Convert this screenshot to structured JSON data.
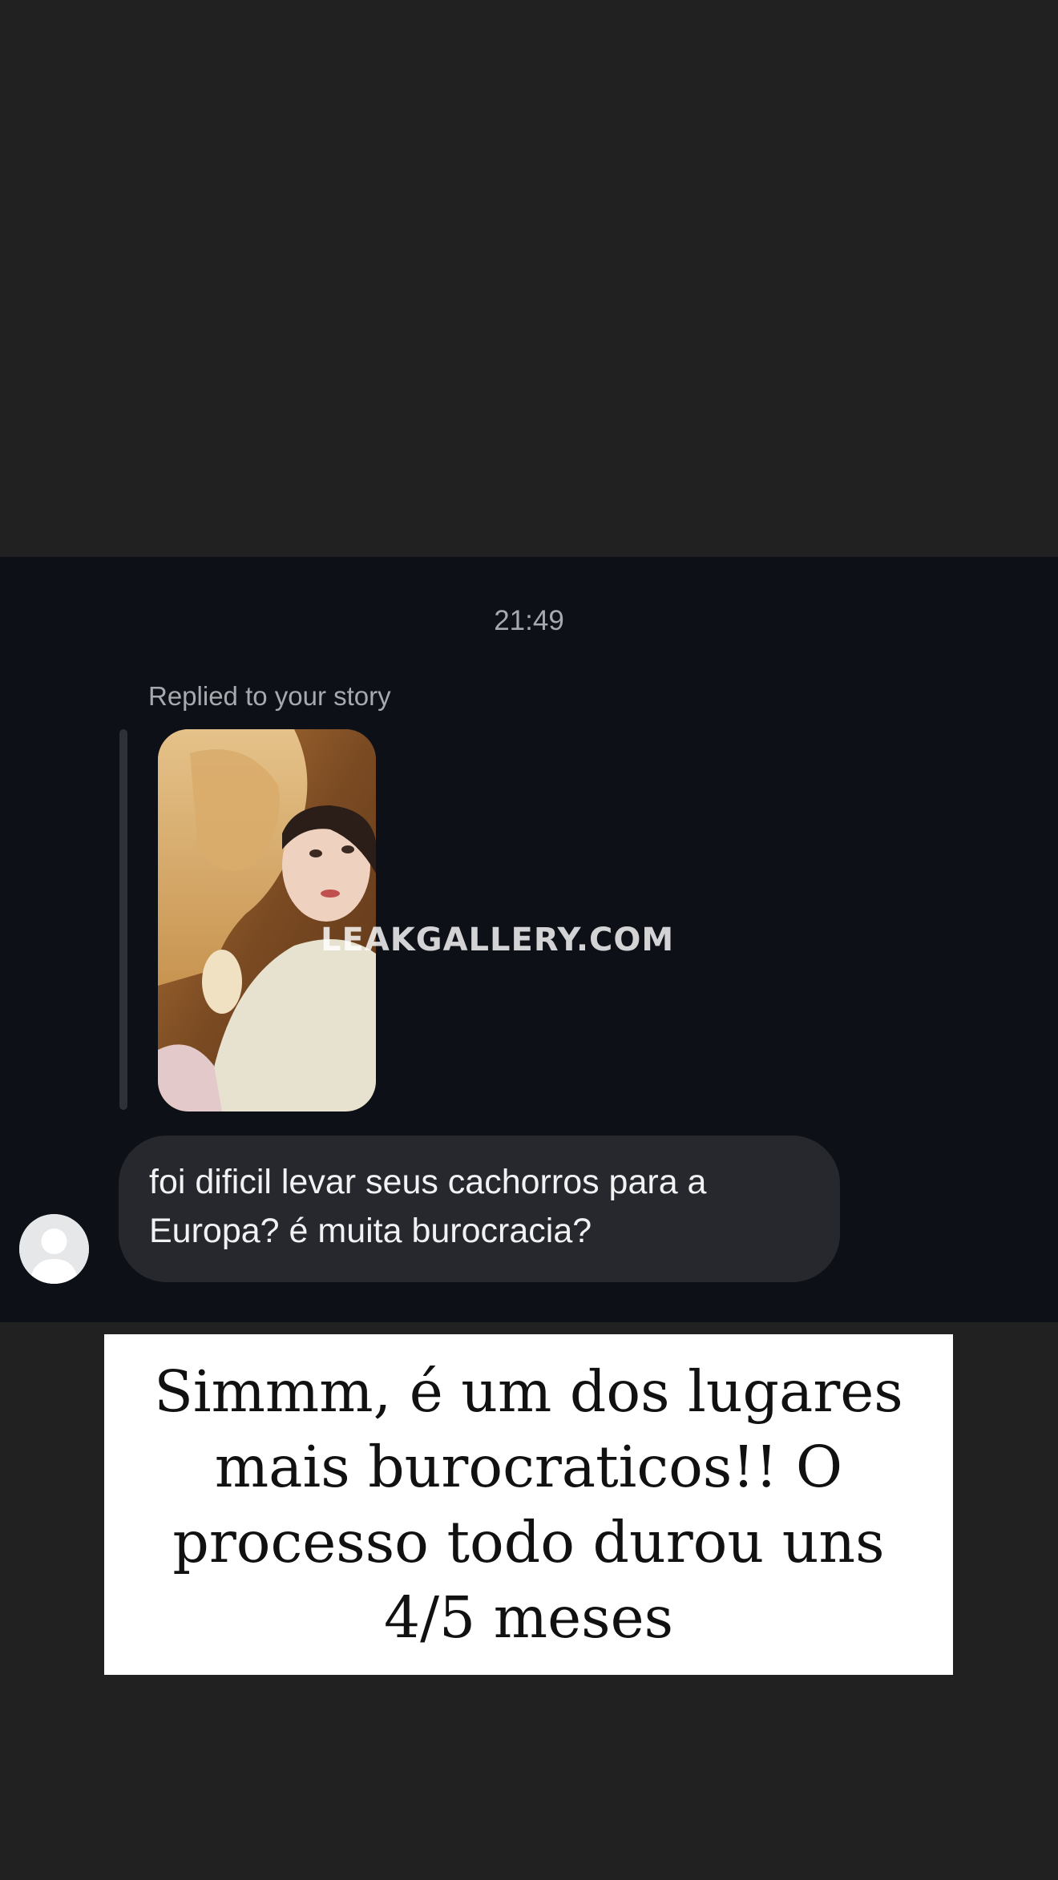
{
  "chat": {
    "timestamp": "21:49",
    "replied_label": "Replied to your story",
    "story_watermark": "LEAKGALLERY.COM",
    "message": "foi dificil levar seus cachorros para a Europa? é muita burocracia?"
  },
  "answer": {
    "text": "Simmm, é um dos lugares mais burocraticos!! O processo todo durou uns 4/5 meses"
  },
  "colors": {
    "page_background": "#212121",
    "chat_background": "#0d1016",
    "bubble_background": "#26282d",
    "answer_card": "#ffffff"
  }
}
